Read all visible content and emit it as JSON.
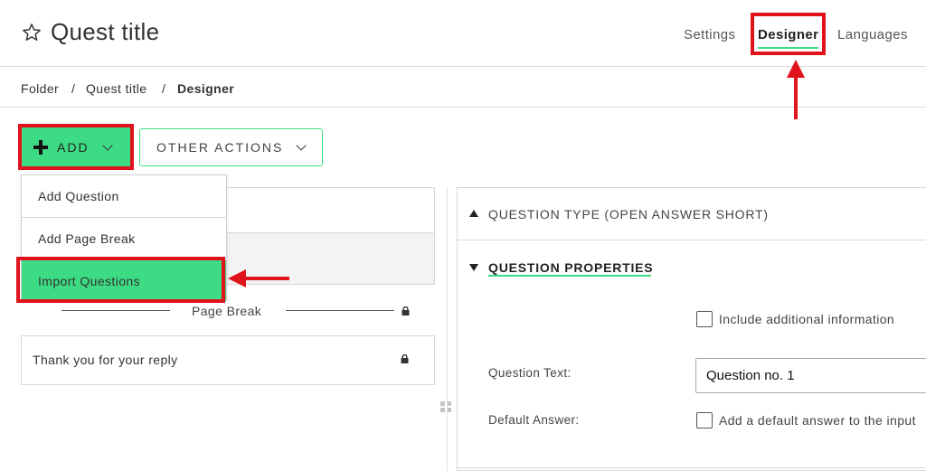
{
  "header": {
    "title": "Quest title",
    "nav": {
      "settings": "Settings",
      "designer": "Designer",
      "languages": "Languages"
    }
  },
  "breadcrumb": {
    "folder": "Folder",
    "separator": "/",
    "quest": "Quest title",
    "current": "Designer"
  },
  "toolbar": {
    "add_label": "ADD",
    "other_actions_label": "OTHER ACTIONS"
  },
  "add_menu": {
    "items": [
      "Add Question",
      "Add Page Break",
      "Import Questions"
    ]
  },
  "left_panel": {
    "page_break_label": "Page Break",
    "thank_you_label": "Thank you for your reply"
  },
  "right_panel": {
    "question_type_label": "QUESTION TYPE (OPEN ANSWER SHORT)",
    "question_properties_label": "QUESTION PROPERTIES",
    "include_additional_label": "Include additional information",
    "question_text_label": "Question Text:",
    "question_text_value": "Question no. 1",
    "default_answer_label": "Default Answer:",
    "default_answer_checkbox_label": "Add a default answer to the input"
  },
  "colors": {
    "accent_green": "#3ddc84",
    "annotation_red": "#e0121b"
  },
  "icons": [
    "star-icon",
    "plus-icon",
    "chevron-down-icon",
    "lock-icon",
    "triangle-up-icon",
    "triangle-down-icon",
    "drag-handle-icon"
  ]
}
